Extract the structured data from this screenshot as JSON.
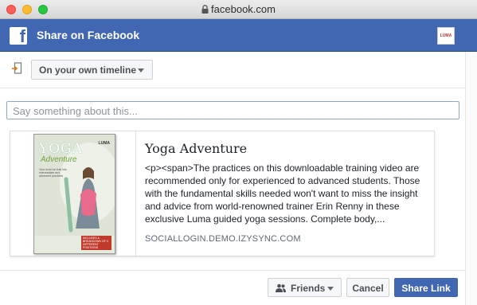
{
  "window": {
    "address": "facebook.com"
  },
  "header": {
    "logo": "f",
    "title": "Share on Facebook",
    "app_logo_text": "LUMA"
  },
  "audience": {
    "selected": "On your own timeline"
  },
  "composer": {
    "placeholder": "Say something about this..."
  },
  "preview": {
    "title": "Yoga Adventure",
    "description": "<p><span>The practices on this downloadable training video are recommended only for experienced to advanced students. Those with the fundamental skills needed won't want to miss the insight and advice from world-renowned trainer Erin Renny in these exclusive Luma guided yoga sessions. Complete body,...",
    "domain": "SOCIALLOGIN.DEMO.IZYSYNC.COM",
    "thumbnail": {
      "title": "YOGA",
      "subtitle": "Adventure",
      "brand": "LUMA",
      "blurb": "Your most fun trail into intermediate and advanced practices",
      "badge": "INCLUDES A BREAKDOWN OF 3 DIFFERENT POSITIONS"
    }
  },
  "footer": {
    "privacy_label": "Friends",
    "cancel_label": "Cancel",
    "share_label": "Share Link"
  },
  "colors": {
    "brand": "#4267b2",
    "page_bg": "#e9ebee"
  }
}
